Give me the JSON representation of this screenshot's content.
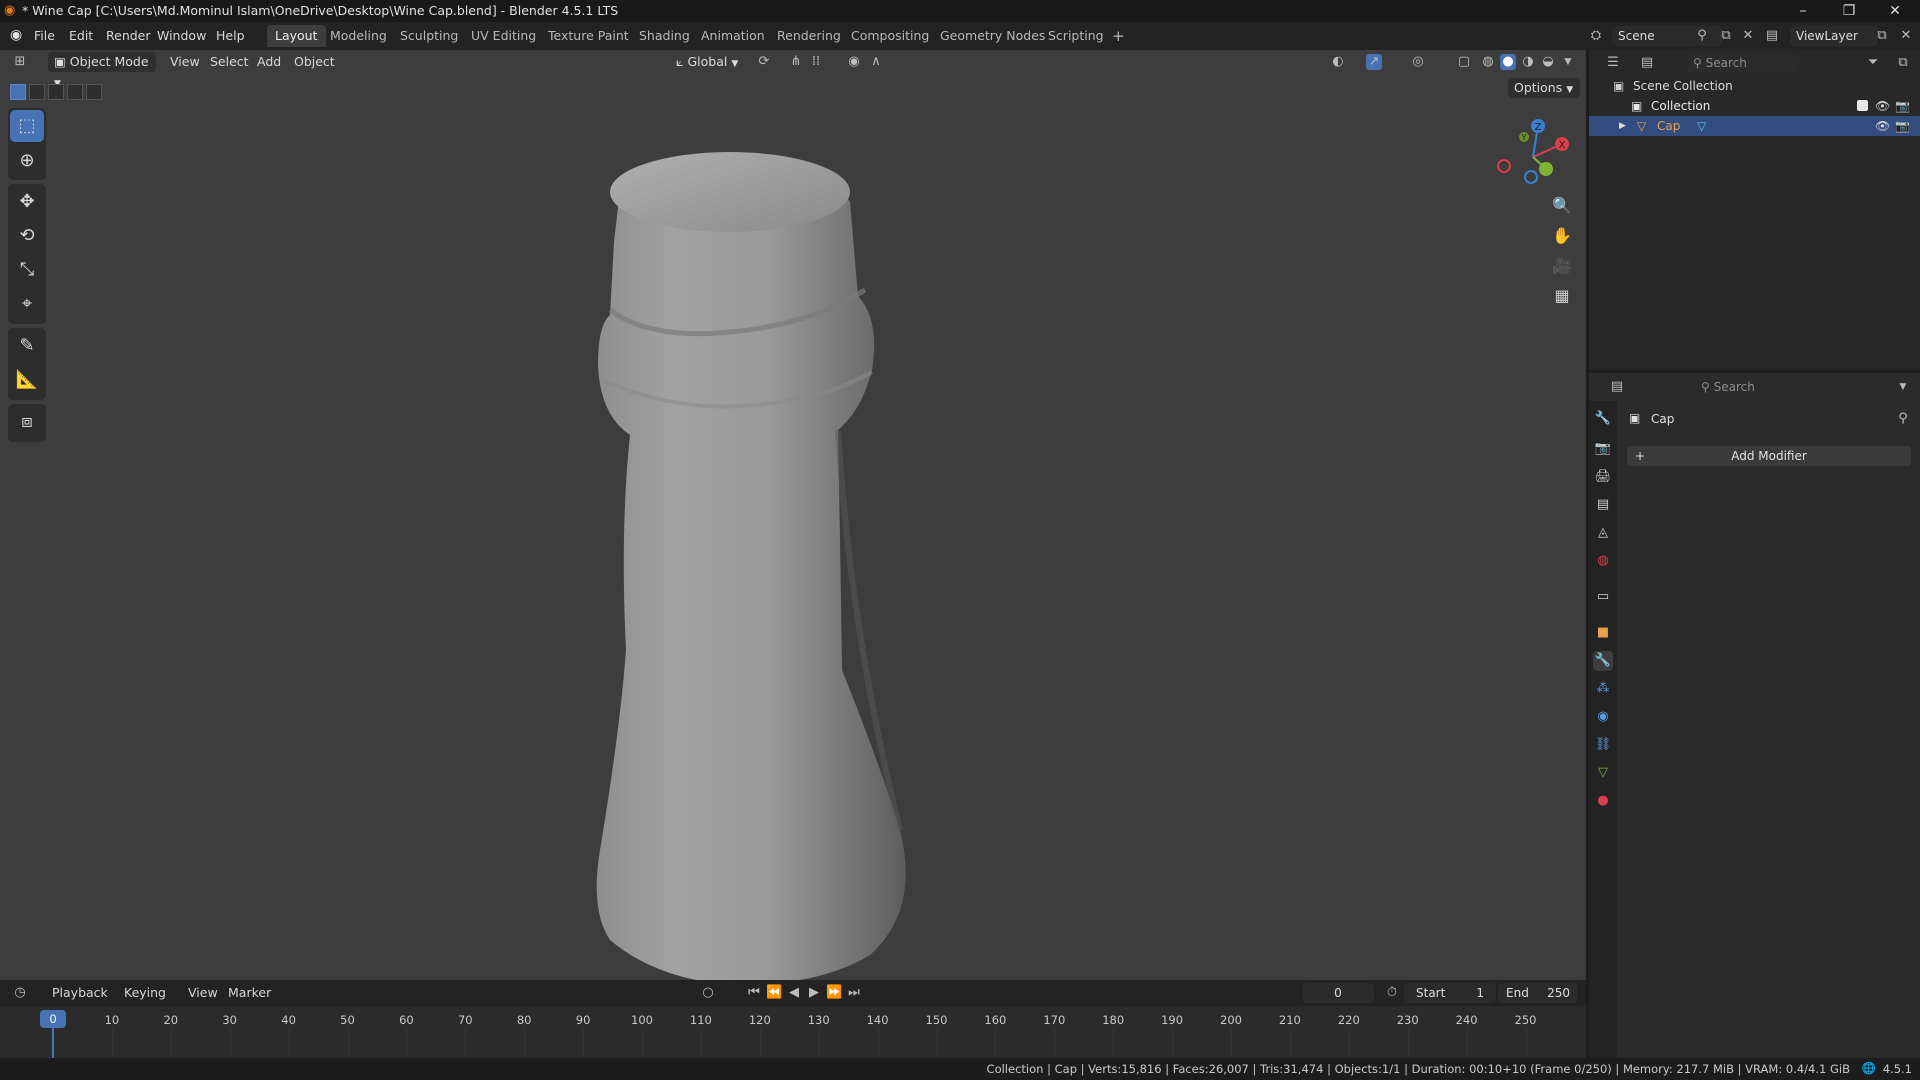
{
  "window": {
    "title": "* Wine Cap [C:\\Users\\Md.Mominul Islam\\OneDrive\\Desktop\\Wine Cap.blend] - Blender 4.5.1 LTS",
    "minimize": "–",
    "maximize": "❐",
    "close": "✕"
  },
  "menubar": {
    "items": [
      "File",
      "Edit",
      "Render",
      "Window",
      "Help"
    ]
  },
  "workspaces": {
    "tabs": [
      "Layout",
      "Modeling",
      "Sculpting",
      "UV Editing",
      "Texture Paint",
      "Shading",
      "Animation",
      "Rendering",
      "Compositing",
      "Geometry Nodes",
      "Scripting"
    ],
    "active": "Layout",
    "add": "+"
  },
  "scene": {
    "name": "Scene",
    "view_layer": "ViewLayer"
  },
  "viewport": {
    "mode": "Object Mode",
    "menus": [
      "View",
      "Select",
      "Add",
      "Object"
    ],
    "orientation": "Global",
    "options_label": "Options",
    "gizmo": {
      "x": "X",
      "y": "Y",
      "z": "Z"
    }
  },
  "outliner": {
    "search_placeholder": "Search",
    "root": "Scene Collection",
    "collection": "Collection",
    "object": "Cap"
  },
  "properties": {
    "search_placeholder": "Search",
    "object_name": "Cap",
    "add_modifier": "Add Modifier"
  },
  "timeline": {
    "menus": [
      "Playback",
      "Keying",
      "View",
      "Marker"
    ],
    "current_frame": "0",
    "start_label": "Start",
    "start_value": "1",
    "end_label": "End",
    "end_value": "250",
    "ticks": [
      "0",
      "10",
      "20",
      "30",
      "40",
      "50",
      "60",
      "70",
      "80",
      "90",
      "100",
      "110",
      "120",
      "130",
      "140",
      "150",
      "160",
      "170",
      "180",
      "190",
      "200",
      "210",
      "220",
      "230",
      "240",
      "250"
    ]
  },
  "statusbar": {
    "text": "Collection | Cap | Verts:15,816 | Faces:26,007 | Tris:31,474 | Objects:1/1 | Duration: 00:10+10 (Frame 0/250) | Memory: 217.7 MiB | VRAM: 0.4/4.1 GiB",
    "version": "4.5.1"
  },
  "colors": {
    "accent": "#4772b3",
    "viewport_bg": "#3d3d3d",
    "object_orange": "#e9a04c",
    "playhead": "#4772b3"
  }
}
